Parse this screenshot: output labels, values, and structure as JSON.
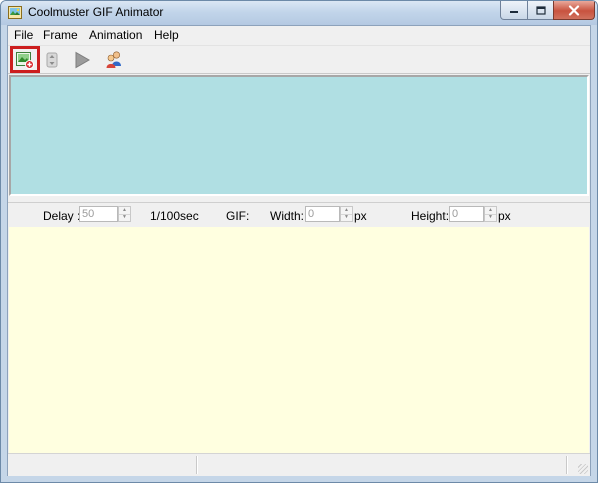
{
  "window": {
    "title": "Coolmuster GIF Animator",
    "controls": {
      "minimize": "minimize",
      "maximize": "maximize",
      "close": "close"
    }
  },
  "menu": {
    "items": [
      {
        "label": "File"
      },
      {
        "label": "Frame"
      },
      {
        "label": "Animation"
      },
      {
        "label": "Help"
      }
    ]
  },
  "toolbar": {
    "tools": [
      {
        "icon": "add-image-icon",
        "highlighted": true
      },
      {
        "icon": "frame-settings-icon",
        "disabled": true
      },
      {
        "icon": "play-icon",
        "disabled": true
      },
      {
        "icon": "users-icon",
        "disabled": false
      }
    ],
    "highlight_color": "#cc1e1e"
  },
  "properties": {
    "delay_label": "Delay :",
    "delay_value": "50",
    "delay_unit": "1/100sec",
    "gif_label": "GIF:",
    "width_label": "Width:",
    "width_value": "0",
    "width_unit": "px",
    "height_label": "Height:",
    "height_value": "0",
    "height_unit": "px"
  },
  "colors": {
    "frame_pane": "#b0dfe3",
    "preview_pane": "#ffffe0"
  }
}
